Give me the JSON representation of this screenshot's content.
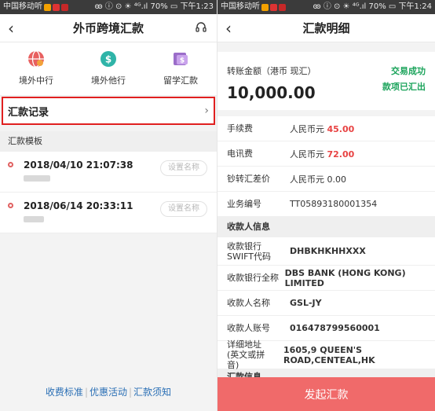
{
  "left": {
    "status": {
      "carrier": "中国移动听",
      "right": "ꙭ ⓘ ⊙ ☀ ⁴ᴳ.ıl 70% ▭ 下午1:23"
    },
    "nav": {
      "title": "外币跨境汇款"
    },
    "shortcuts": [
      {
        "label": "境外中行",
        "icon": "globe-money-icon"
      },
      {
        "label": "境外他行",
        "icon": "dollar-transfer-icon"
      },
      {
        "label": "留学汇款",
        "icon": "study-remit-icon"
      }
    ],
    "records_label": "汇款记录",
    "templates_header": "汇款模板",
    "templates": [
      {
        "time": "2018/04/10 21:07:38",
        "button": "设置名称"
      },
      {
        "time": "2018/06/14 20:33:11",
        "button": "设置名称"
      }
    ],
    "links": [
      "收费标准",
      "优惠活动",
      "汇款须知"
    ],
    "link_sep": "|"
  },
  "right": {
    "status": {
      "carrier": "中国移动听",
      "right": "ꙭ ⓘ ⊙ ☀ ⁴ᴳ.ıl 70% ▭ 下午1:24"
    },
    "nav": {
      "title": "汇款明细"
    },
    "amount": {
      "label": "转账金额（港币 现汇）",
      "value": "10,000.00",
      "status1": "交易成功",
      "status2": "款项已汇出"
    },
    "fees": [
      {
        "key": "手续费",
        "prefix": "人民币元",
        "value": "45.00"
      },
      {
        "key": "电讯费",
        "prefix": "人民币元",
        "value": "72.00"
      },
      {
        "key": "钞转汇差价",
        "prefix": "",
        "value": "人民币元 0.00"
      },
      {
        "key": "业务编号",
        "prefix": "",
        "value": "TT05893180001354"
      }
    ],
    "payee_header": "收款人信息",
    "payee": [
      {
        "key": "收款银行SWIFT代码",
        "value": "DHBKHKHHXXX"
      },
      {
        "key": "收款银行全称",
        "value": "DBS BANK (HONG KONG) LIMITED"
      },
      {
        "key": "收款人名称",
        "value": "GSL-JY"
      },
      {
        "key": "收款人账号",
        "value": "016478799560001"
      },
      {
        "key": "详细地址(英文或拼音)",
        "value": "1605,9 QUEEN'S ROAD,CENTEAL,HK"
      }
    ],
    "cut_section": "汇款信息",
    "submit": "发起汇款"
  },
  "colors": {
    "red_border": "#e02020",
    "green": "#1aa35a",
    "submit_bg": "#f06a6a",
    "fee_red": "#e84343",
    "link_blue": "#2a6fb5"
  }
}
